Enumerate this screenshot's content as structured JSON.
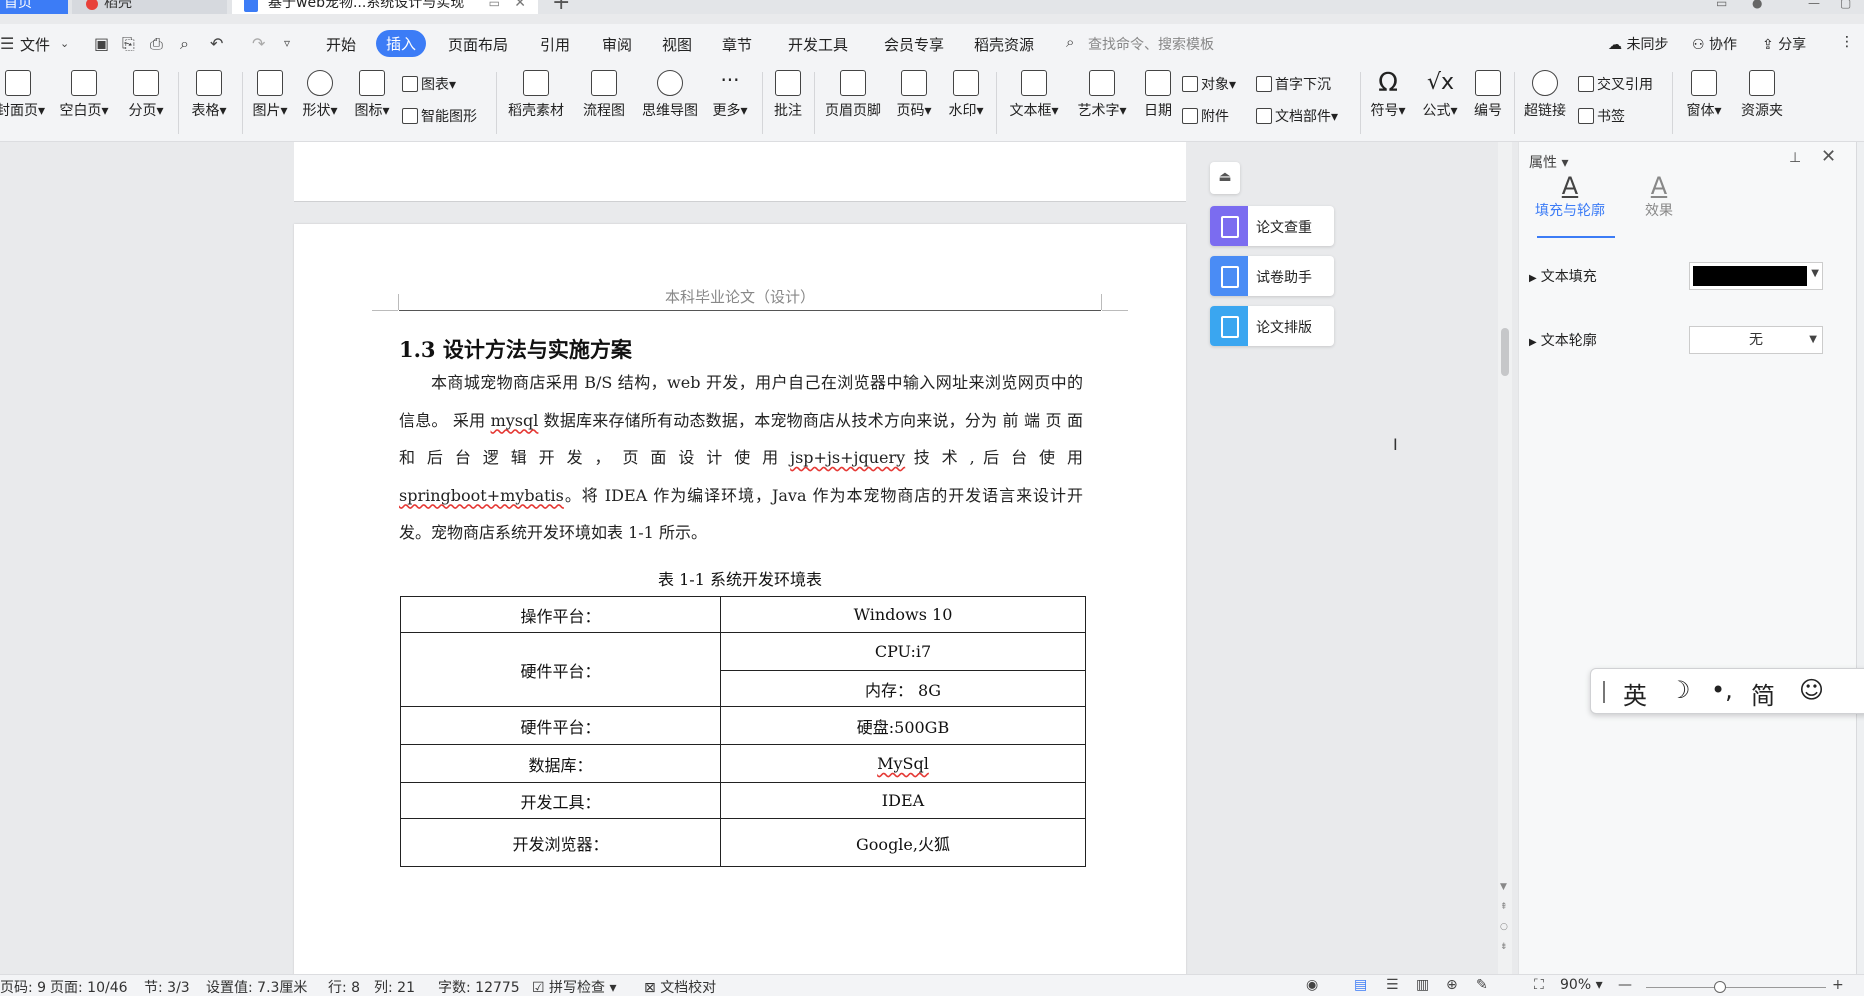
{
  "tabs": {
    "home": "首页",
    "daoke": "稻壳",
    "document": "基于web宠物...系统设计与实现"
  },
  "menu": {
    "file": "文件",
    "items": [
      "开始",
      "插入",
      "页面布局",
      "引用",
      "审阅",
      "视图",
      "章节",
      "开发工具",
      "会员专享",
      "稻壳资源"
    ],
    "active": "插入",
    "search_placeholder": "查找命令、搜索模板",
    "unsynced": "未同步",
    "collaborate": "协作",
    "share": "分享"
  },
  "ribbon": {
    "cover": "封面页",
    "blank": "空白页",
    "page_break": "分页",
    "table": "表格",
    "picture": "图片",
    "shape": "形状",
    "icon": "图标",
    "chart": "图表",
    "smart_art": "智能图形",
    "daoke_material": "稻壳素材",
    "flowchart": "流程图",
    "mindmap": "思维导图",
    "more": "更多",
    "comment": "批注",
    "header_footer": "页眉页脚",
    "page_number": "页码",
    "watermark": "水印",
    "textbox": "文本框",
    "wordart": "艺术字",
    "date": "日期",
    "object": "对象",
    "attachment": "附件",
    "drop_cap": "首字下沉",
    "doc_parts": "文档部件",
    "symbol": "符号",
    "formula": "公式",
    "numbering": "编号",
    "hyperlink": "超链接",
    "cross_ref": "交叉引用",
    "bookmark": "书签",
    "window": "窗体",
    "resource": "资源夹"
  },
  "document": {
    "page_header": "本科毕业论文（设计）",
    "section_title": "1.3  设计方法与实施方案",
    "paragraph": {
      "s1": "本商城宠物商店采用 B/S 结构，web 开发，用户自己在浏览器中输入网址来浏览网页中的信息。 采用 ",
      "mysql": "mysql",
      "s2": " 数据库来存储所有动态数据，本宠物商店从技术方向来说，分为 前 端 页 面 和 后 台 逻 辑 开 发 ， 页 面 设 计 使 用 ",
      "jsp": "jsp+js+jquery",
      "s3": " 技 术 , 后 台 使 用 ",
      "spring": "springboot+mybatis",
      "s4": "。将 IDEA 作为编译环境，Java 作为本宠物商店的开发语言来设计开发。宠物商店系统开发环境如表 1-1 所示。"
    },
    "table_caption": "表 1-1  系统开发环境表",
    "table": {
      "r1": [
        "操作平台：",
        "Windows 10"
      ],
      "r2_label": "硬件平台：",
      "r2_values": [
        "CPU:i7",
        "内存：  8G"
      ],
      "r3": [
        "硬件平台：",
        "硬盘:500GB"
      ],
      "r4": [
        "数据库：",
        "MySql"
      ],
      "r5": [
        "开发工具：",
        "IDEA"
      ],
      "r6": [
        "开发浏览器：",
        "Google,火狐"
      ]
    }
  },
  "float_tools": [
    "论文查重",
    "试卷助手",
    "论文排版"
  ],
  "float_colors": [
    "#7b6cf0",
    "#4a8cf5",
    "#3aa6f0"
  ],
  "panel": {
    "title": "属性",
    "tab_fill": "填充与轮廓",
    "tab_effect": "效果",
    "text_fill": "文本填充",
    "text_outline": "文本轮廓",
    "outline_value": "无",
    "fill_color": "#000000"
  },
  "ime": {
    "lang": "英",
    "moon": "☽",
    "punct": "•,",
    "simp": "简",
    "emoji": "☺"
  },
  "status": {
    "page_code": "页码: 9",
    "pages": "页面: 10/46",
    "section": "节: 3/3",
    "setting": "设置值: 7.3厘米",
    "row": "行: 8",
    "col": "列: 21",
    "words": "字数: 12775",
    "spell": "拼写检查",
    "proof": "文档校对",
    "zoom": "90%"
  },
  "accent": "#3c7cf6"
}
